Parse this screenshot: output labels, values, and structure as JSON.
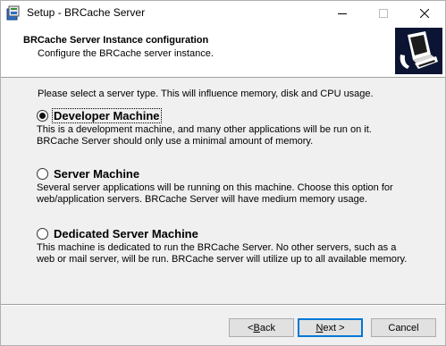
{
  "window": {
    "title": "Setup - BRCache Server"
  },
  "header": {
    "title": "BRCache Server Instance configuration",
    "subtitle": "Configure the BRCache server instance."
  },
  "content": {
    "intro": "Please select a server type. This will influence memory, disk and CPU usage.",
    "options": [
      {
        "label": "Developer Machine",
        "selected": true,
        "description": [
          "This is a development machine, and many other applications will be run on it.",
          "BRCache Server should only use a minimal amount of memory."
        ]
      },
      {
        "label": "Server Machine",
        "selected": false,
        "description": [
          "Several server applications will be running on this machine. Choose this option for",
          "web/application servers. BRCache Server will have medium memory usage."
        ]
      },
      {
        "label": "Dedicated Server Machine",
        "selected": false,
        "description": [
          "This machine is dedicated to run the BRCache Server. No other servers, such as a",
          "web or mail server, will be run. BRCache server will utilize up to all available memory."
        ]
      }
    ]
  },
  "buttons": {
    "back": {
      "prefix": "< ",
      "accel": "B",
      "rest": "ack"
    },
    "next": {
      "accel": "N",
      "rest": "ext >"
    },
    "cancel": "Cancel"
  },
  "colors": {
    "accent": "#0078d7",
    "header_bg": "#ffffff",
    "body_bg": "#f0f0f0",
    "logo_bg": "#0b1433"
  },
  "icons": {
    "app": "setup-installer-icon",
    "header": "server-computer-icon",
    "minimize": "minimize-icon",
    "maximize": "maximize-icon",
    "close": "close-icon"
  }
}
